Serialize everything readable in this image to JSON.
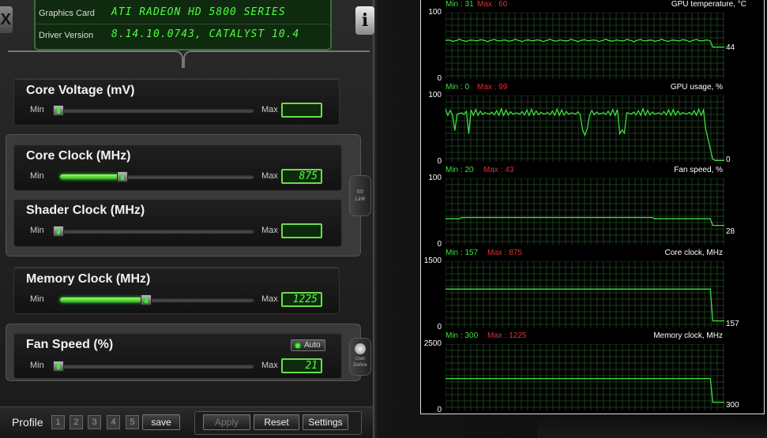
{
  "info": {
    "graphics_card_label": "Graphics Card",
    "graphics_card_value": "ATI RADEON HD 5800 SERIES",
    "driver_label": "Driver Version",
    "driver_value": "8.14.10.0743, CATALYST 10.4"
  },
  "logo_letter": "X",
  "info_button": "i",
  "min_label": "Min",
  "max_label": "Max",
  "sliders": {
    "core_voltage": {
      "title": "Core Voltage (mV)",
      "value": "",
      "level": 0
    },
    "core_clock": {
      "title": "Core Clock (MHz)",
      "value": "875",
      "level": 0.32
    },
    "shader_clock": {
      "title": "Shader Clock (MHz)",
      "value": "",
      "level": 0
    },
    "memory_clock": {
      "title": "Memory Clock (MHz)",
      "value": "1225",
      "level": 0.44
    },
    "fan_speed": {
      "title": "Fan Speed (%)",
      "value": "21",
      "level": 0
    }
  },
  "link_button": "Link",
  "user_define_button": "User Define",
  "auto_button": "Auto",
  "bottom": {
    "profile_label": "Profile",
    "profiles": [
      "1",
      "2",
      "3",
      "4",
      "5"
    ],
    "save_label": "save",
    "apply_label": "Apply",
    "reset_label": "Reset",
    "settings_label": "Settings"
  },
  "graphs": [
    {
      "title": "GPU temperature, °C",
      "min_text": "Min : 31",
      "max_text": "Max : 60",
      "y_top": "100",
      "y_bottom": "0",
      "current": "44"
    },
    {
      "title": "GPU usage, %",
      "min_text": "Min : 0",
      "max_text": "Max : 99",
      "y_top": "100",
      "y_bottom": "0",
      "current": "0"
    },
    {
      "title": "Fan speed, %",
      "min_text": "Min : 20",
      "max_text": "Max : 43",
      "y_top": "100",
      "y_bottom": "0",
      "current": "28"
    },
    {
      "title": "Core clock, MHz",
      "min_text": "Min : 157",
      "max_text": "Max : 875",
      "y_top": "1500",
      "y_bottom": "0",
      "current": "157"
    },
    {
      "title": "Memory clock, MHz",
      "min_text": "Min : 300",
      "max_text": "Max : 1225",
      "y_top": "2500",
      "y_bottom": "0",
      "current": "300"
    }
  ],
  "colors": {
    "accent_green": "#4cff3c",
    "max_red": "#e03030",
    "line_green": "#3ee03e"
  }
}
